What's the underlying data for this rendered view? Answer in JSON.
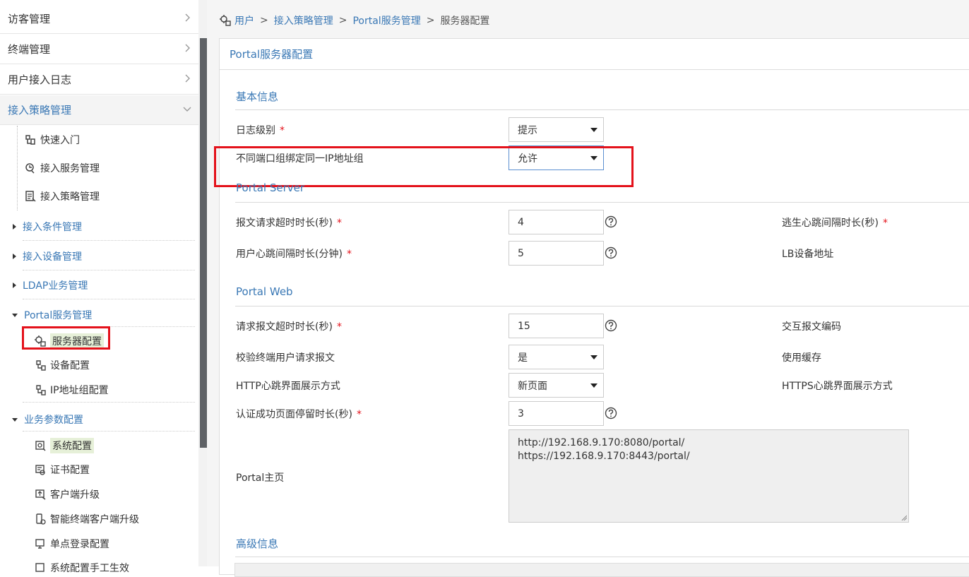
{
  "sidebar": {
    "top_items": [
      {
        "label": "访客管理"
      },
      {
        "label": "终端管理"
      },
      {
        "label": "用户接入日志"
      },
      {
        "label": "接入策略管理"
      }
    ],
    "policy_children": [
      {
        "label": "快速入门"
      },
      {
        "label": "接入服务管理"
      },
      {
        "label": "接入策略管理"
      }
    ],
    "groups": [
      {
        "label": "接入条件管理"
      },
      {
        "label": "接入设备管理"
      },
      {
        "label": "LDAP业务管理"
      },
      {
        "label": "Portal服务管理"
      },
      {
        "label": "业务参数配置"
      }
    ],
    "portal_children": [
      {
        "label": "服务器配置"
      },
      {
        "label": "设备配置"
      },
      {
        "label": "IP地址组配置"
      }
    ],
    "param_children": [
      {
        "label": "系统配置"
      },
      {
        "label": "证书配置"
      },
      {
        "label": "客户端升级"
      },
      {
        "label": "智能终端客户端升级"
      },
      {
        "label": "单点登录配置"
      },
      {
        "label": "系统配置手工生效"
      }
    ]
  },
  "breadcrumb": {
    "items": [
      "用户",
      "接入策略管理",
      "Portal服务管理",
      "服务器配置"
    ],
    "separator": ">"
  },
  "panel": {
    "title": "Portal服务器配置",
    "sections": {
      "basic": "基本信息",
      "server": "Portal Server",
      "web": "Portal Web",
      "advanced": "高级信息"
    },
    "basic": {
      "log_level_label": "日志级别",
      "log_level_value": "提示",
      "bind_label": "不同端口组绑定同一IP地址组",
      "bind_value": "允许"
    },
    "server": {
      "timeout_label": "报文请求超时时长(秒)",
      "timeout_value": "4",
      "heartbeat_label": "用户心跳间隔时长(分钟)",
      "heartbeat_value": "5",
      "escape_label": "逃生心跳间隔时长(秒)",
      "lb_label": "LB设备地址"
    },
    "web": {
      "req_timeout_label": "请求报文超时时长(秒)",
      "req_timeout_value": "15",
      "verify_label": "校验终端用户请求报文",
      "verify_value": "是",
      "http_label": "HTTP心跳界面展示方式",
      "http_value": "新页面",
      "stay_label": "认证成功页面停留时长(秒)",
      "stay_value": "3",
      "homepage_label": "Portal主页",
      "homepage_lines": [
        "http://192.168.9.170:8080/portal/",
        "https://192.168.9.170:8443/portal/"
      ],
      "encoding_label": "交互报文编码",
      "cache_label": "使用缓存",
      "https_label": "HTTPS心跳界面展示方式"
    },
    "required_mark": "*"
  },
  "colors": {
    "accent": "#3a78b5",
    "highlight_box": "#e4121b",
    "required": "#e4121b"
  }
}
